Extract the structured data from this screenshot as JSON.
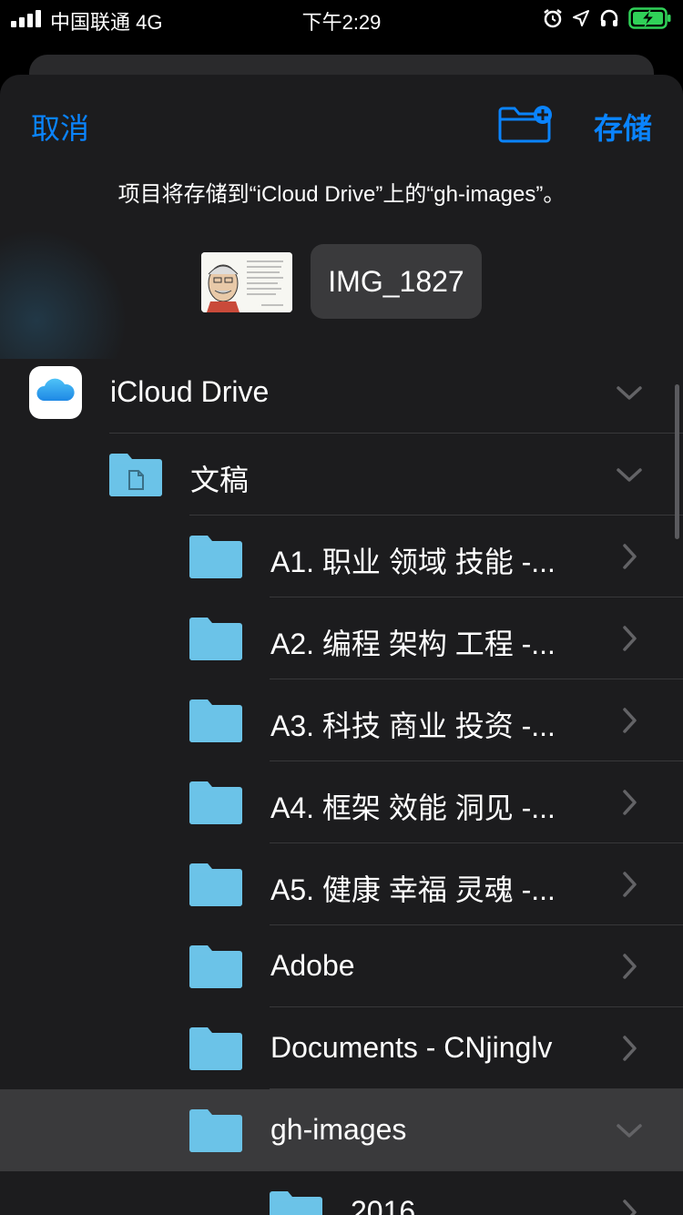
{
  "status": {
    "carrier": "中国联通 4G",
    "time": "下午2:29"
  },
  "sheet": {
    "cancel_label": "取消",
    "save_label": "存储",
    "subtitle": "项目将存储到“iCloud Drive”上的“gh-images”。",
    "filename": "IMG_1827"
  },
  "rows": [
    {
      "label": "iCloud Drive",
      "type": "icloud",
      "chevron": "down"
    },
    {
      "label": "文稿",
      "type": "doc-folder",
      "chevron": "down"
    },
    {
      "label": "A1. 职业 领域 技能 -...",
      "type": "folder",
      "chevron": "right"
    },
    {
      "label": "A2. 编程 架构 工程 -...",
      "type": "folder",
      "chevron": "right"
    },
    {
      "label": "A3. 科技 商业 投资 -...",
      "type": "folder",
      "chevron": "right"
    },
    {
      "label": "A4. 框架 效能 洞见 -...",
      "type": "folder",
      "chevron": "right"
    },
    {
      "label": "A5. 健康 幸福 灵魂 -...",
      "type": "folder",
      "chevron": "right"
    },
    {
      "label": "Adobe",
      "type": "folder",
      "chevron": "right"
    },
    {
      "label": "Documents - CNjinglv",
      "type": "folder",
      "chevron": "right"
    },
    {
      "label": "gh-images",
      "type": "folder",
      "chevron": "down",
      "selected": true
    },
    {
      "label": "2016",
      "type": "folder",
      "chevron": "right"
    }
  ],
  "colors": {
    "accent": "#0a84ff",
    "folder": "#6cc3e8",
    "battery": "#30d158"
  }
}
